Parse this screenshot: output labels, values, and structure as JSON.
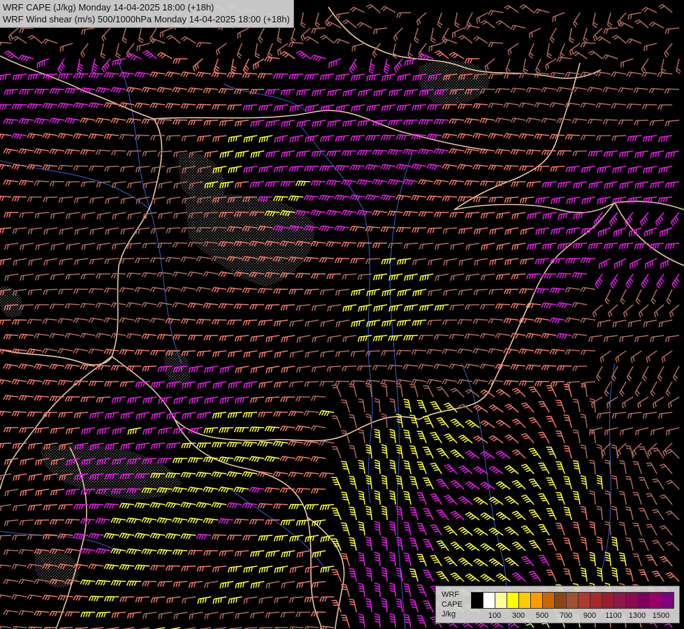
{
  "title": {
    "line1": "WRF CAPE (J/kg) Monday 14-04-2025 18:00 (+18h)",
    "line2": "WRF Wind shear (m/s) 500/1000hPa Monday 14-04-2025 18:00 (+18h)"
  },
  "legend": {
    "label1": "WRF",
    "label2": "CAPE",
    "label3": "J/kg",
    "colors": [
      "#000000",
      "#ffffff",
      "#ffff99",
      "#ffff00",
      "#ffcc00",
      "#ff9900",
      "#cc6600",
      "#8b4513",
      "#a0522d",
      "#b03a2e",
      "#a52a2a",
      "#9b1b30",
      "#8b1a4a",
      "#8b0a50",
      "#800060",
      "#990066",
      "#800080"
    ],
    "ticks": [
      "100",
      "300",
      "500",
      "700",
      "900",
      "1100",
      "1300",
      "1500"
    ]
  },
  "map": {
    "barb_colors": {
      "weak": "#b06a5e",
      "moderate": "#f07868",
      "strong": "#e81ee8",
      "high_cape": "#ffff30"
    },
    "border_color": "#e8c8a0",
    "river_color": "#3a5fd0",
    "terrain_pattern_color": "#9a9a9a"
  }
}
